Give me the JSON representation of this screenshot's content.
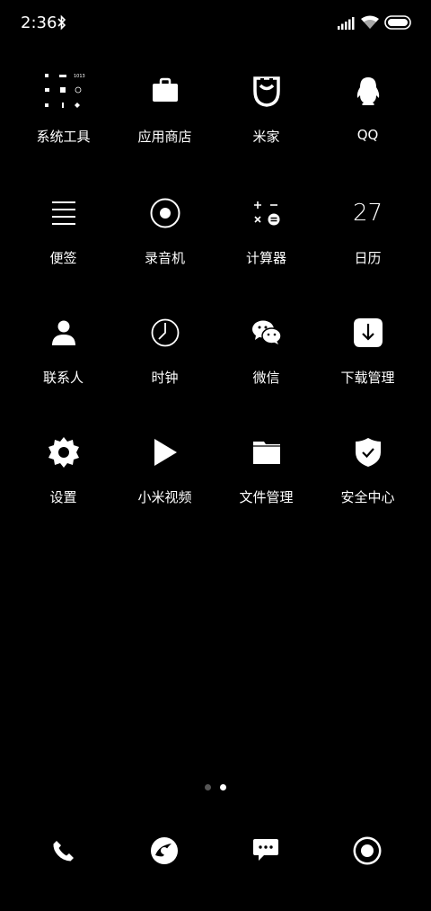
{
  "status_bar": {
    "time": "2:36",
    "icons": [
      "bluetooth-icon",
      "signal-icon",
      "wifi-icon",
      "battery-icon"
    ]
  },
  "apps": [
    {
      "label": "系统工具",
      "icon": "folder-system-tools-icon"
    },
    {
      "label": "应用商店",
      "icon": "app-store-icon"
    },
    {
      "label": "米家",
      "icon": "mijia-icon"
    },
    {
      "label": "QQ",
      "icon": "qq-penguin-icon"
    },
    {
      "label": "便签",
      "icon": "notes-icon"
    },
    {
      "label": "录音机",
      "icon": "recorder-icon"
    },
    {
      "label": "计算器",
      "icon": "calculator-icon"
    },
    {
      "label": "日历",
      "icon": "calendar-icon",
      "date": "27"
    },
    {
      "label": "联系人",
      "icon": "contacts-icon"
    },
    {
      "label": "时钟",
      "icon": "clock-icon"
    },
    {
      "label": "微信",
      "icon": "wechat-icon"
    },
    {
      "label": "下载管理",
      "icon": "download-icon"
    },
    {
      "label": "设置",
      "icon": "settings-gear-icon"
    },
    {
      "label": "小米视频",
      "icon": "video-play-icon"
    },
    {
      "label": "文件管理",
      "icon": "file-manager-icon"
    },
    {
      "label": "安全中心",
      "icon": "security-shield-icon"
    }
  ],
  "folder_preview": {
    "badge": "1013"
  },
  "page_indicator": {
    "count": 2,
    "active": 2
  },
  "dock": [
    {
      "icon": "phone-icon"
    },
    {
      "icon": "browser-icon"
    },
    {
      "icon": "messages-icon"
    },
    {
      "icon": "camera-icon"
    }
  ]
}
